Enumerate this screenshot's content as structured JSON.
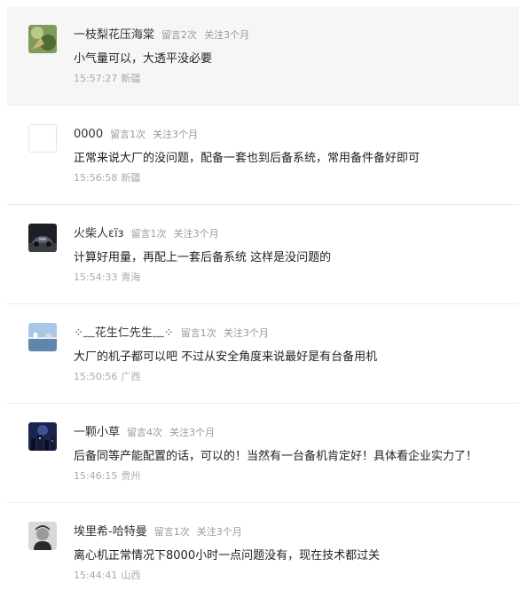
{
  "comments": [
    {
      "avatar_icon": "green-plant-avatar-icon",
      "name": "一枝梨花压海棠",
      "replies": "留言2次",
      "follow": "关注3个月",
      "text": "小气量可以，大透平没必要",
      "time": "15:57:27",
      "location": "新疆",
      "highlighted": true
    },
    {
      "avatar_icon": "blank-avatar-icon",
      "name": "0000",
      "replies": "留言1次",
      "follow": "关注3个月",
      "text": "正常来说大厂的没问题，配备一套也到后备系统，常用备件备好即可",
      "time": "15:56:58",
      "location": "新疆"
    },
    {
      "avatar_icon": "car-avatar-icon",
      "name": "火柴人εïз",
      "replies": "留言1次",
      "follow": "关注3个月",
      "text": "计算好用量，再配上一套后备系统 这样是没问题的",
      "time": "15:54:33",
      "location": "青海"
    },
    {
      "avatar_icon": "seaside-avatar-icon",
      "name": "⁘﹏花生仁先生﹏⁘",
      "replies": "留言1次",
      "follow": "关注3个月",
      "text": "大厂的机子都可以吧 不过从安全角度来说最好是有台备用机",
      "time": "15:50:56",
      "location": "广西"
    },
    {
      "avatar_icon": "night-city-avatar-icon",
      "name": "一颗小草",
      "replies": "留言4次",
      "follow": "关注3个月",
      "text": "后备同等产能配置的话，可以的！当然有一台备机肯定好！具体看企业实力了！",
      "time": "15:46:15",
      "location": "贵州"
    },
    {
      "avatar_icon": "portrait-avatar-icon",
      "name": "埃里希-哈特曼",
      "replies": "留言1次",
      "follow": "关注3个月",
      "text": "离心机正常情况下8000小时一点问题没有，现在技术都过关",
      "time": "15:44:41",
      "location": "山西"
    }
  ]
}
